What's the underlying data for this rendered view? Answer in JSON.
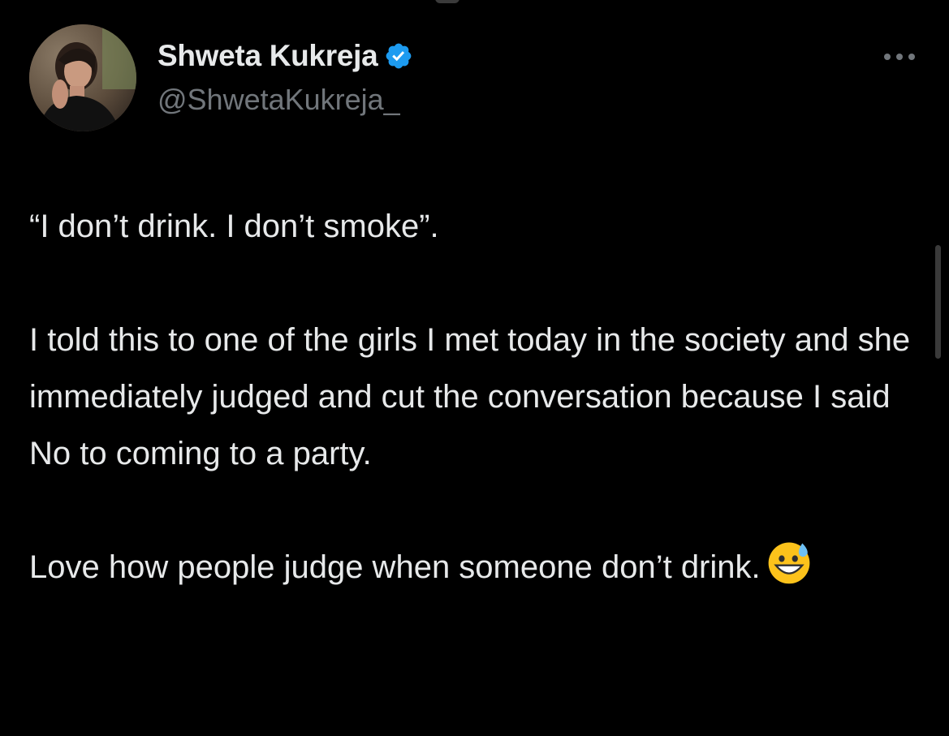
{
  "author": {
    "display_name": "Shweta Kukreja",
    "handle": "@ShwetaKukreja_",
    "verified_icon": "verified-badge-icon",
    "avatar_icon": "profile-photo"
  },
  "tweet": {
    "paragraphs": [
      "“I don’t drink. I don’t smoke”.",
      "I told this to one of the girls I met today in the society and she immediately judged and cut the conversation because I said No to coming to a party.",
      "Love how people judge when someone don’t drink."
    ],
    "emoji": "grinning-face-with-sweat"
  },
  "menu": {
    "more_icon": "more-horizontal-icon"
  },
  "colors": {
    "background": "#000000",
    "primary_text": "#e7e9ea",
    "secondary_text": "#71767b",
    "verified_blue": "#1d9bf0"
  }
}
